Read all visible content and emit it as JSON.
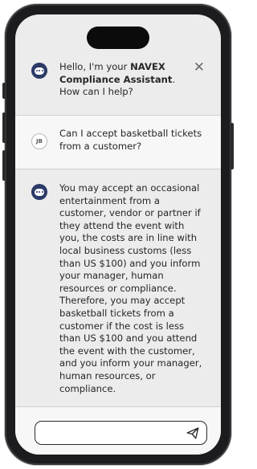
{
  "header": {
    "greeting_prefix": "Hello, I'm your ",
    "brand": "NAVEX Compliance Assistant",
    "greeting_suffix": ".",
    "prompt": "How can I help?",
    "close_glyph": "✕"
  },
  "messages": [
    {
      "role": "user",
      "avatar_initials": "JB",
      "text": "Can I accept basketball tickets from a customer?"
    },
    {
      "role": "assistant",
      "text": "You may accept an occasional entertainment from a customer, vendor or partner if they attend the event with you, the costs are in line with local business customs (less than US $100) and you inform your manager, human resources or compliance. Therefore, you may accept basketball tickets from a customer if the cost is less than US $100 and you attend the event with the customer, and you inform your manager, human resources, or compliance."
    }
  ],
  "input": {
    "value": "",
    "placeholder": ""
  },
  "icons": {
    "assistant_avatar": "chat-bubble-icon",
    "close": "close-icon",
    "send": "send-icon"
  },
  "colors": {
    "accent": "#2b3a67",
    "assistant_bg": "#ececec",
    "user_bg": "#f7f7f7"
  }
}
